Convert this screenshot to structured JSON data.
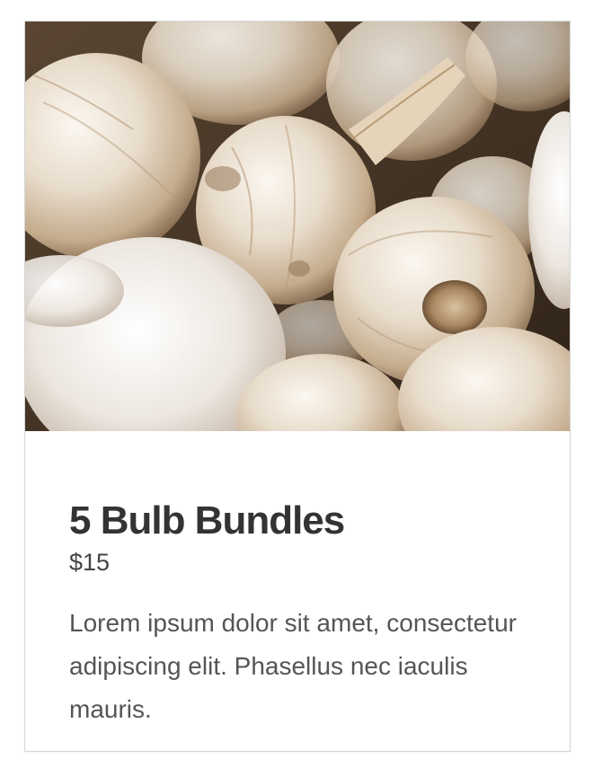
{
  "product": {
    "image_alt": "garlic-bulbs-photo",
    "title": "5 Bulb Bundles",
    "price": "$15",
    "description": "Lorem ipsum dolor sit amet, consectetur adipiscing elit. Phasellus nec iaculis mauris."
  },
  "colors": {
    "title": "#333333",
    "price": "#444444",
    "description": "#555555",
    "card_border": "#d6d6d6"
  }
}
